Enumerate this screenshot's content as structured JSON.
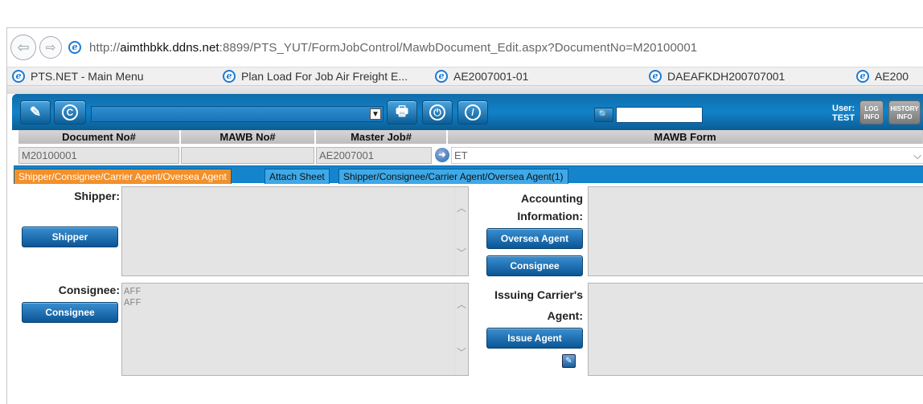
{
  "browser": {
    "url_prefix": "http://",
    "url_host": "aimthbkk.ddns.net",
    "url_rest": ":8899/PTS_YUT/FormJobControl/MawbDocument_Edit.aspx?DocumentNo=M20100001",
    "favorites": [
      {
        "label": "PTS.NET - Main Menu"
      },
      {
        "label": "Plan Load For Job Air Freight E..."
      },
      {
        "label": "AE2007001-01"
      },
      {
        "label": "DAEAFKDH200707001"
      },
      {
        "label": "AE200"
      }
    ]
  },
  "toolbar": {
    "user_label": "User:",
    "user_name": "TEST",
    "log_info": "LOG INFO",
    "history_info": "HISTORY INFO"
  },
  "header": {
    "document_no_label": "Document No#",
    "mawb_no_label": "MAWB No#",
    "master_job_label": "Master Job#",
    "mawb_form_label": "MAWB Form",
    "document_no": "M20100001",
    "mawb_no": "",
    "master_job": "AE2007001",
    "mawb_form": "ET"
  },
  "tabs": [
    {
      "label": "Shipper/Consignee/Carrier Agent/Oversea Agent",
      "active": true
    },
    {
      "label": "Attach Sheet",
      "active": false
    },
    {
      "label": "Shipper/Consignee/Carrier Agent/Oversea Agent(1)",
      "active": false
    }
  ],
  "form": {
    "shipper_label": "Shipper:",
    "shipper_button": "Shipper",
    "shipper_text": "",
    "consignee_label": "Consignee:",
    "consignee_button": "Consignee",
    "consignee_text": "AFF\nAFF",
    "accounting_label_1": "Accounting",
    "accounting_label_2": "Information:",
    "oversea_agent_button": "Oversea Agent",
    "consignee_button_2": "Consignee",
    "issuing_label_1": "Issuing Carrier's",
    "issuing_label_2": "Agent:",
    "issue_agent_button": "Issue Agent"
  },
  "colors": {
    "toolbar_blue": "#1182c8",
    "active_tab": "#f3902a",
    "button_blue": "#0a5596"
  }
}
